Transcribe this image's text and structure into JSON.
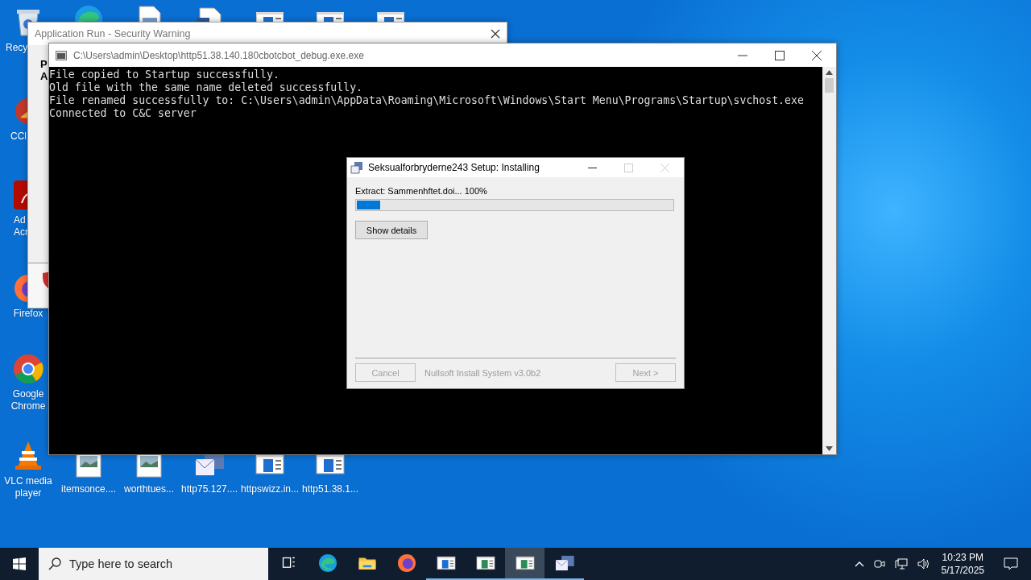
{
  "desktop_icons": [
    {
      "kind": "recycle-bin",
      "label": "Recy"
    },
    {
      "kind": "edge"
    },
    {
      "kind": "document"
    },
    {
      "kind": "word"
    },
    {
      "kind": "window-file"
    },
    {
      "kind": "window-file"
    },
    {
      "kind": "window-file"
    },
    {
      "kind": "ccleaner",
      "label": "CCl"
    },
    {
      "kind": "acrobat",
      "label": "Ad Acr"
    },
    {
      "kind": "firefox",
      "label": "Firefox"
    },
    {
      "kind": "chrome",
      "label": "Google Chrome"
    },
    {
      "kind": "vlc",
      "label": "VLC media player"
    },
    {
      "kind": "image",
      "label": "itemsonce...."
    },
    {
      "kind": "image",
      "label": "worthtues..."
    },
    {
      "kind": "mail",
      "label": "http75.127...."
    },
    {
      "kind": "window-file",
      "label": "httpswizz.in..."
    },
    {
      "kind": "window-file",
      "label": "http51.38.1..."
    }
  ],
  "security_window": {
    "title": "Application Run - Security Warning",
    "body_lines": [
      "P",
      "A"
    ]
  },
  "console_window": {
    "title": "C:\\Users\\admin\\Desktop\\http51.38.140.180cbotcbot_debug.exe.exe",
    "lines": [
      "File copied to Startup successfully.",
      "Old file with the same name deleted successfully.",
      "File renamed successfully to: C:\\Users\\admin\\AppData\\Roaming\\Microsoft\\Windows\\Start Menu\\Programs\\Startup\\svchost.exe",
      "Connected to C&C server"
    ]
  },
  "installer_window": {
    "title": "Seksualforbryderne243 Setup: Installing",
    "status": "Extract: Sammenhftet.doi... 100%",
    "progress": {
      "level": 0.075
    },
    "details_button": {
      "label": "Show details",
      "disabled": false
    },
    "cancel_button": {
      "label": "Cancel",
      "disabled": true
    },
    "branding": "Nullsoft Install System v3.0b2",
    "next_button": {
      "label": "Next >",
      "disabled": true
    }
  },
  "taskbar": {
    "search_placeholder": "Type here to search",
    "apps": [
      {
        "kind": "task-view",
        "running": false,
        "selected": false
      },
      {
        "kind": "edge",
        "running": false,
        "selected": false
      },
      {
        "kind": "folder",
        "running": false,
        "selected": false
      },
      {
        "kind": "firefox",
        "running": false,
        "selected": false
      },
      {
        "kind": "window-file",
        "running": true,
        "selected": false
      },
      {
        "kind": "console-app",
        "running": true,
        "selected": false
      },
      {
        "kind": "console-app",
        "running": true,
        "selected": true
      },
      {
        "kind": "mail",
        "running": true,
        "selected": false
      }
    ],
    "time": "10:23 PM",
    "date": "5/17/2025"
  }
}
